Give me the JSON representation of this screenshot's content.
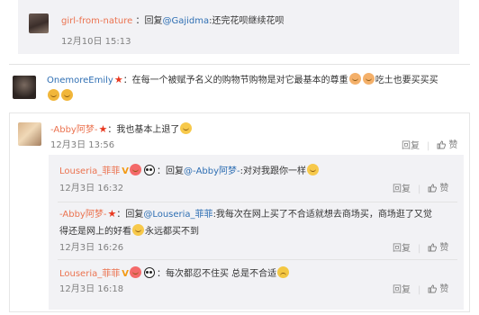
{
  "comments": [
    {
      "user": "girl-from-nature",
      "reply_prefix": "回复",
      "mention": "@Gajidma",
      "text": ":还完花呗继续花呗",
      "time": "12月10日 15:13"
    },
    {
      "user": "OnemoreEmily",
      "text": "：在每一个被赋予名义的购物节购物是对它最基本的尊重",
      "text_cont": "吃土也要买买买"
    },
    {
      "user": "-Abby阿梦-",
      "text": "：我也基本上退了",
      "time": "12月3日 13:56",
      "reply_label": "回复",
      "like_label": "赞"
    }
  ],
  "replies": [
    {
      "user": "Louseria_菲菲",
      "badge": "V",
      "reply_prefix": "：回复",
      "mention": "@-Abby阿梦-",
      "text": ":对对我跟你一样",
      "time": "12月3日 16:32",
      "reply_label": "回复",
      "like_label": "赞"
    },
    {
      "user": "-Abby阿梦-",
      "reply_prefix": "：回复",
      "mention": "@Louseria_菲菲",
      "text": ":我每次在网上买了不合适就想去商场买，商场逛了又觉",
      "text_cont": "得还是网上的好看",
      "text_cont2": "永远都买不到",
      "time": "12月3日 16:26",
      "reply_label": "回复",
      "like_label": "赞"
    },
    {
      "user": "Louseria_菲菲",
      "badge": "V",
      "text": "：每次都忍不住买  总是不合适",
      "time": "12月3日 16:18",
      "reply_label": "回复",
      "like_label": "赞"
    }
  ],
  "colors": {
    "link_orange": "#eb7350",
    "link_blue": "#2f6fb3",
    "meta_gray": "#808080",
    "panel_bg": "#f2f2f5"
  }
}
